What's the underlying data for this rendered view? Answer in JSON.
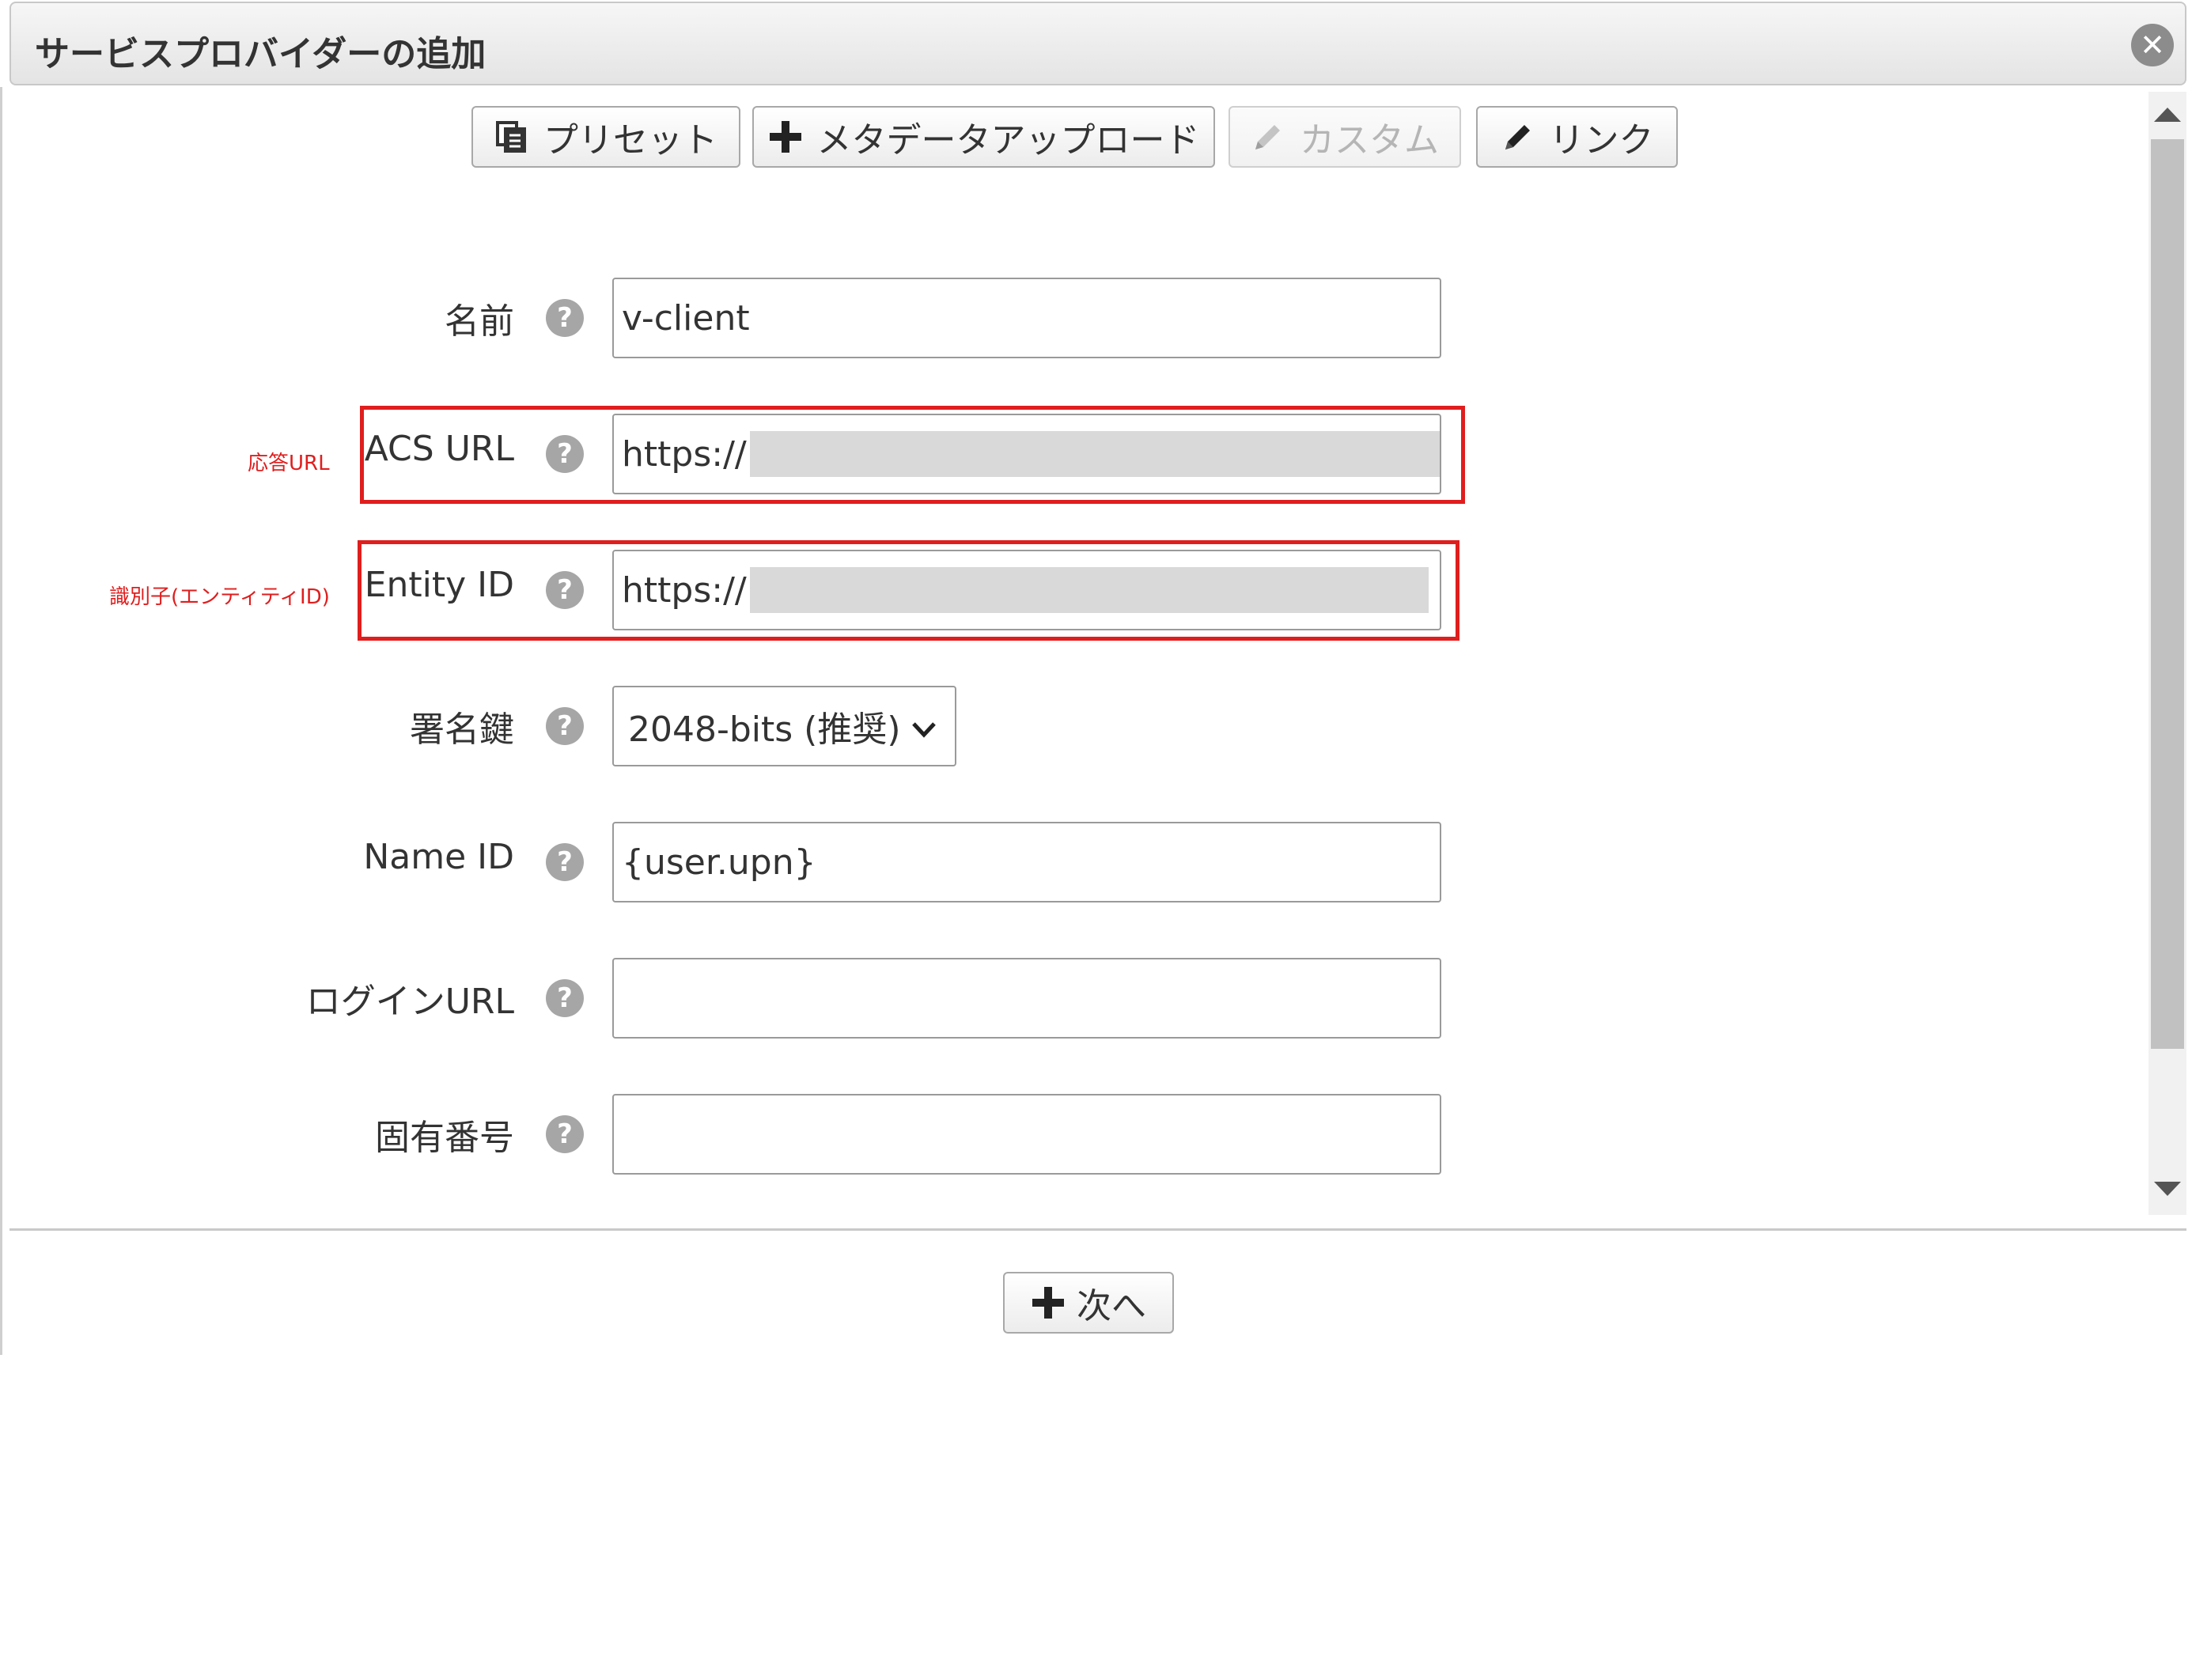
{
  "dialog": {
    "title": "サービスプロバイダーの追加",
    "close_glyph": "✕"
  },
  "toolbar": {
    "preset_label": "プリセット",
    "upload_label": "メタデータアップロード",
    "custom_label": "カスタム",
    "link_label": "リンク"
  },
  "form": {
    "name": {
      "label": "名前",
      "value": "v-client"
    },
    "acs_url": {
      "label": "ACS URL",
      "value": "https://",
      "annotation": "応答URL"
    },
    "entity_id": {
      "label": "Entity ID",
      "value": "https://",
      "annotation": "識別子(エンティティID)"
    },
    "signing_key": {
      "label": "署名鍵",
      "selected": "2048-bits (推奨)"
    },
    "name_id": {
      "label": "Name ID",
      "value": "{user.upn}"
    },
    "login_url": {
      "label": "ログインURL",
      "value": ""
    },
    "unique_number": {
      "label": "固有番号",
      "value": ""
    },
    "help_glyph": "?"
  },
  "footer": {
    "next_label": "次へ"
  },
  "colors": {
    "highlight": "#e01e1e",
    "help_icon": "#a6a6a6",
    "disabled_text": "#b5b5b5"
  }
}
